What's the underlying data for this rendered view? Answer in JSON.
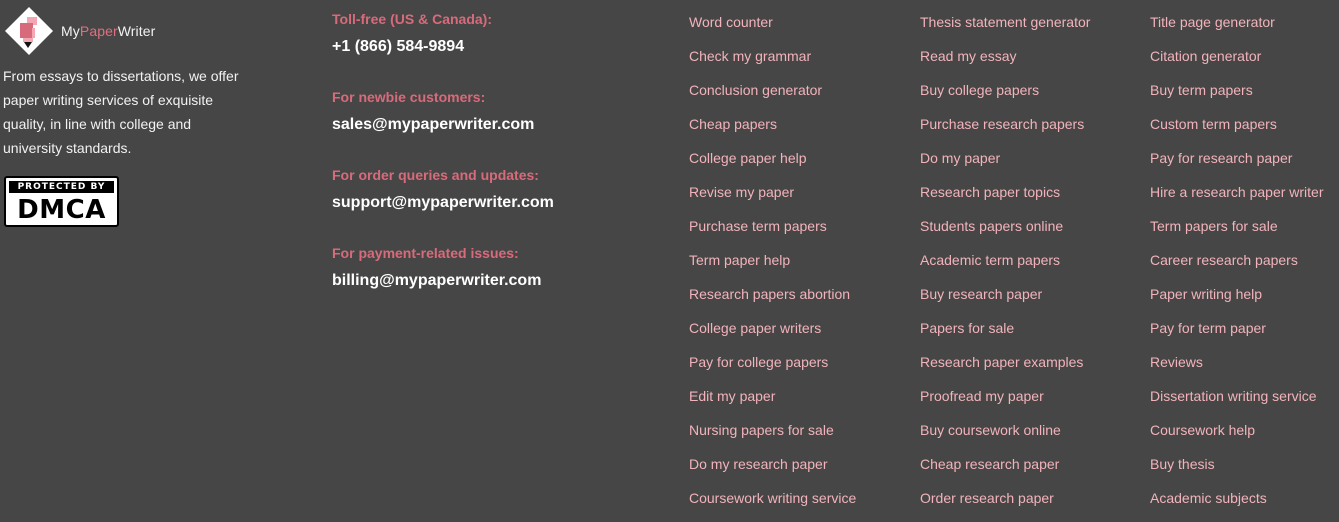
{
  "brand": {
    "name_part1": "My",
    "name_part2": "Paper",
    "name_part3": "Writer",
    "accent_color": "#e0707f",
    "icon": "pen-marker-icon"
  },
  "about_text": "From essays to dissertations, we offer paper writing services of exquisite quality, in line with college and university standards.",
  "dmca": {
    "top": "PROTECTED BY",
    "main": "DMCA"
  },
  "contacts": [
    {
      "label": "Toll-free (US & Canada):",
      "value": "+1 (866) 584-9894"
    },
    {
      "label": "For newbie customers:",
      "value": "sales@mypaperwriter.com"
    },
    {
      "label": "For order queries and updates:",
      "value": "support@mypaperwriter.com"
    },
    {
      "label": "For payment-related issues:",
      "value": "billing@mypaperwriter.com"
    }
  ],
  "colors": {
    "background": "#464646",
    "label": "#d86b7b",
    "link": "#f2b3bb"
  },
  "link_columns": [
    [
      "Word counter",
      "Check my grammar",
      "Conclusion generator",
      "Cheap papers",
      "College paper help",
      "Revise my paper",
      "Purchase term papers",
      "Term paper help",
      "Research papers abortion",
      "College paper writers",
      "Pay for college papers",
      "Edit my paper",
      "Nursing papers for sale",
      "Do my research paper",
      "Coursework writing service"
    ],
    [
      "Thesis statement generator",
      "Read my essay",
      "Buy college papers",
      "Purchase research papers",
      "Do my paper",
      "Research paper topics",
      "Students papers online",
      "Academic term papers",
      "Buy research paper",
      "Papers for sale",
      "Research paper examples",
      "Proofread my paper",
      "Buy coursework online",
      "Cheap research paper",
      "Order research paper"
    ],
    [
      "Title page generator",
      "Citation generator",
      "Buy term papers",
      "Custom term papers",
      "Pay for research paper",
      "Hire a research paper writer",
      "Term papers for sale",
      "Career research papers",
      "Paper writing help",
      "Pay for term paper",
      "Reviews",
      "Dissertation writing service",
      "Coursework help",
      "Buy thesis",
      "Academic subjects"
    ]
  ]
}
